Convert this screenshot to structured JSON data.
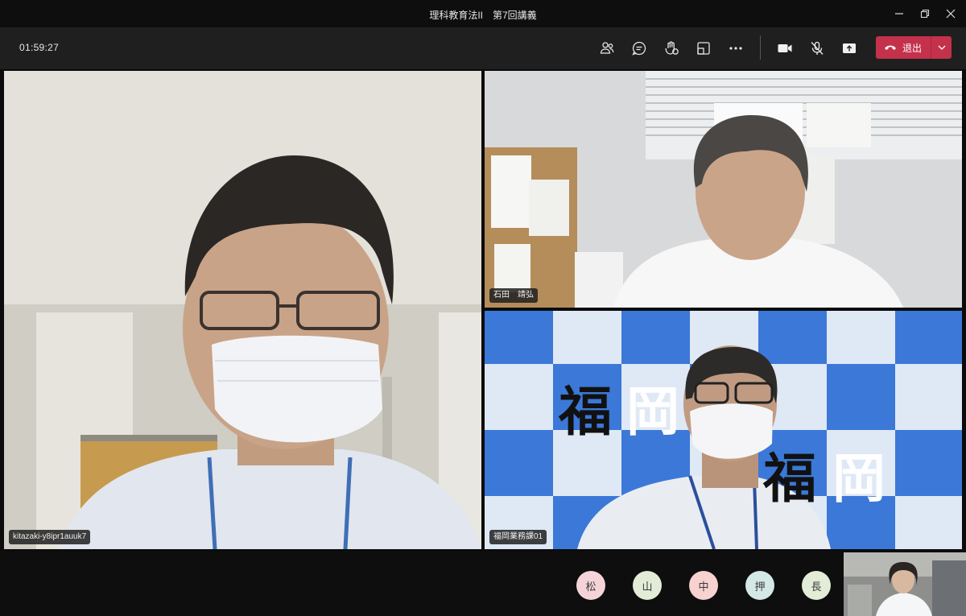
{
  "window": {
    "title": "理科教育法II　第7回講義"
  },
  "toolbar": {
    "timer": "01:59:27",
    "leave_label": "退出",
    "icons": [
      "participants-icon",
      "chat-icon",
      "reactions-icon",
      "rooms-icon",
      "more-icon",
      "camera-icon",
      "mic-off-icon",
      "share-icon"
    ]
  },
  "participants": {
    "large": {
      "name": "kitazaki-y8ipr1auuk7"
    },
    "top_right": {
      "name": "石田　靖弘"
    },
    "bottom_right": {
      "name": "福岡業務課01",
      "bg_text": [
        "福",
        "岡",
        "福",
        "岡"
      ]
    }
  },
  "avatars": [
    {
      "initial": "松",
      "color": "#f5d4d9"
    },
    {
      "initial": "山",
      "color": "#e3ecd6"
    },
    {
      "initial": "中",
      "color": "#f7d2cf"
    },
    {
      "initial": "押",
      "color": "#d4e8e6"
    },
    {
      "initial": "長",
      "color": "#e3ecd6"
    }
  ],
  "colors": {
    "leave": "#c4314b",
    "checker_blue": "#3b78d8",
    "checker_light": "#dfe8f5"
  }
}
